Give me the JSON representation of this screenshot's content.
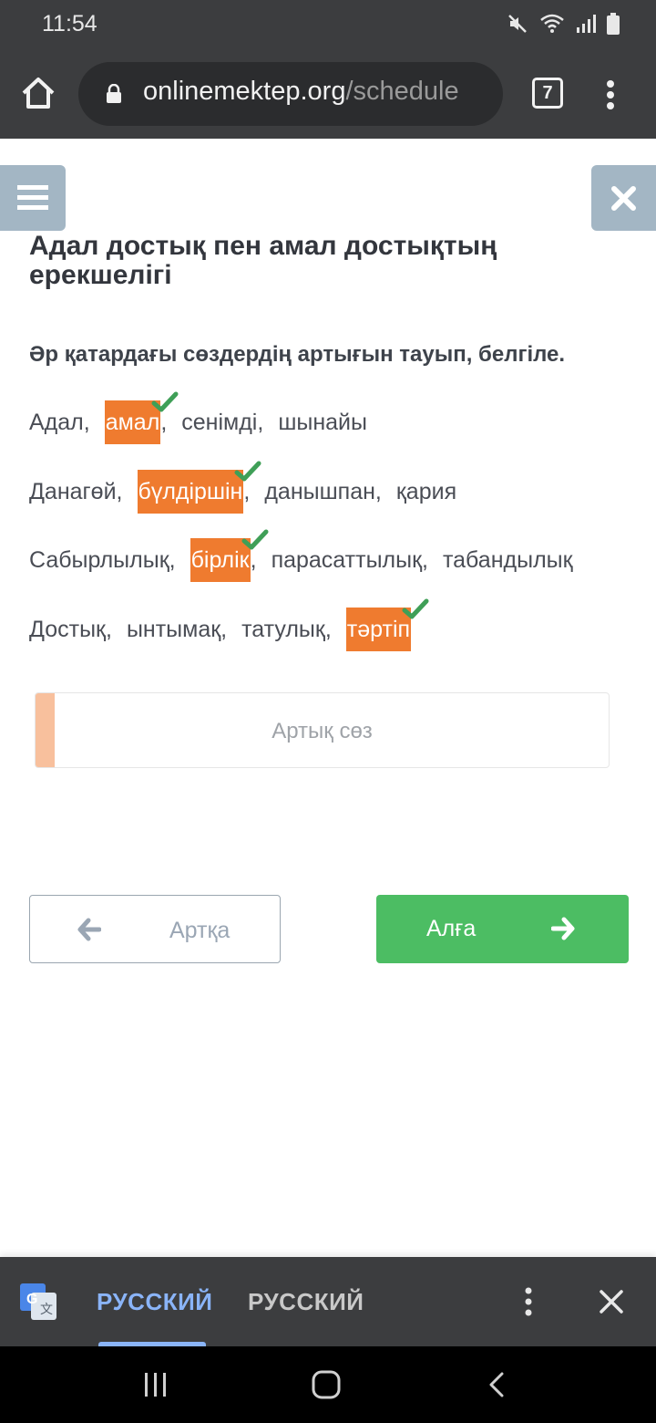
{
  "status_bar": {
    "time": "11:54"
  },
  "browser": {
    "url_host": "onlinemektep.org",
    "url_path": "/schedule",
    "tab_count": "7"
  },
  "page": {
    "title": "Адал достық пен амал достықтың ерекшелігі",
    "instruction": "Әр қатардағы сөздердің артығын тауып, белгіле.",
    "rows": [
      {
        "words": [
          "Адал",
          "амал",
          "сенімді",
          "шынайы"
        ],
        "selected": "амал"
      },
      {
        "words": [
          "Данагөй",
          "бүлдіршін",
          "данышпан",
          "қария"
        ],
        "selected": "бүлдіршін"
      },
      {
        "words": [
          "Сабырлылық",
          "бірлік",
          "парасаттылық",
          "табандылық"
        ],
        "selected": "бірлік"
      },
      {
        "words": [
          "Достық",
          "ынтымақ",
          "татулық",
          "тәртіп"
        ],
        "selected": "тәртіп"
      }
    ],
    "answer_placeholder": "Артық сөз",
    "back_label": "Артқа",
    "next_label": "Алға"
  },
  "translate_bar": {
    "source_lang": "РУССКИЙ",
    "target_lang": "РУССКИЙ"
  },
  "colors": {
    "selected_bg": "#ef7b2f",
    "check": "#3f9f57",
    "next_button": "#4cbd63",
    "side_buttons": "#a3b6c4"
  }
}
